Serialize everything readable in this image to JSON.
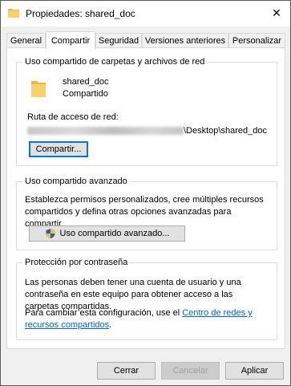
{
  "window": {
    "title": "Propiedades: shared_doc",
    "close_glyph": "✕"
  },
  "tabs": [
    {
      "label": "General",
      "active": false
    },
    {
      "label": "Compartir",
      "active": true
    },
    {
      "label": "Seguridad",
      "active": false
    },
    {
      "label": "Versiones anteriores",
      "active": false
    },
    {
      "label": "Personalizar",
      "active": false
    }
  ],
  "network_sharing": {
    "group_title": "Uso compartido de carpetas y archivos de red",
    "item_name": "shared_doc",
    "item_status": "Compartido",
    "path_label": "Ruta de acceso de red:",
    "path_suffix": "\\Desktop\\shared_doc",
    "share_button": "Compartir..."
  },
  "advanced_sharing": {
    "group_title": "Uso compartido avanzado",
    "description": "Establezca permisos personalizados, cree múltiples recursos compartidos y defina otras opciones avanzadas para compartir.",
    "button": "Uso compartido avanzado..."
  },
  "password_protection": {
    "group_title": "Protección por contraseña",
    "description": "Las personas deben tener una cuenta de usuario y una contraseña en este equipo para obtener acceso a las carpetas compartidas.",
    "change_prefix": "Para cambiar esta configuración, use el ",
    "link_text": "Centro de redes y recursos compartidos",
    "change_suffix": "."
  },
  "footer": {
    "ok": "Cerrar",
    "cancel": "Cancelar",
    "apply": "Aplicar"
  },
  "icons": {
    "title_icon": "folder-icon",
    "item_icon": "folder-icon",
    "shield": "uac-shield-icon"
  },
  "colors": {
    "accent": "#0078d7",
    "link": "#0066cc",
    "folder": "#f7d26a"
  }
}
